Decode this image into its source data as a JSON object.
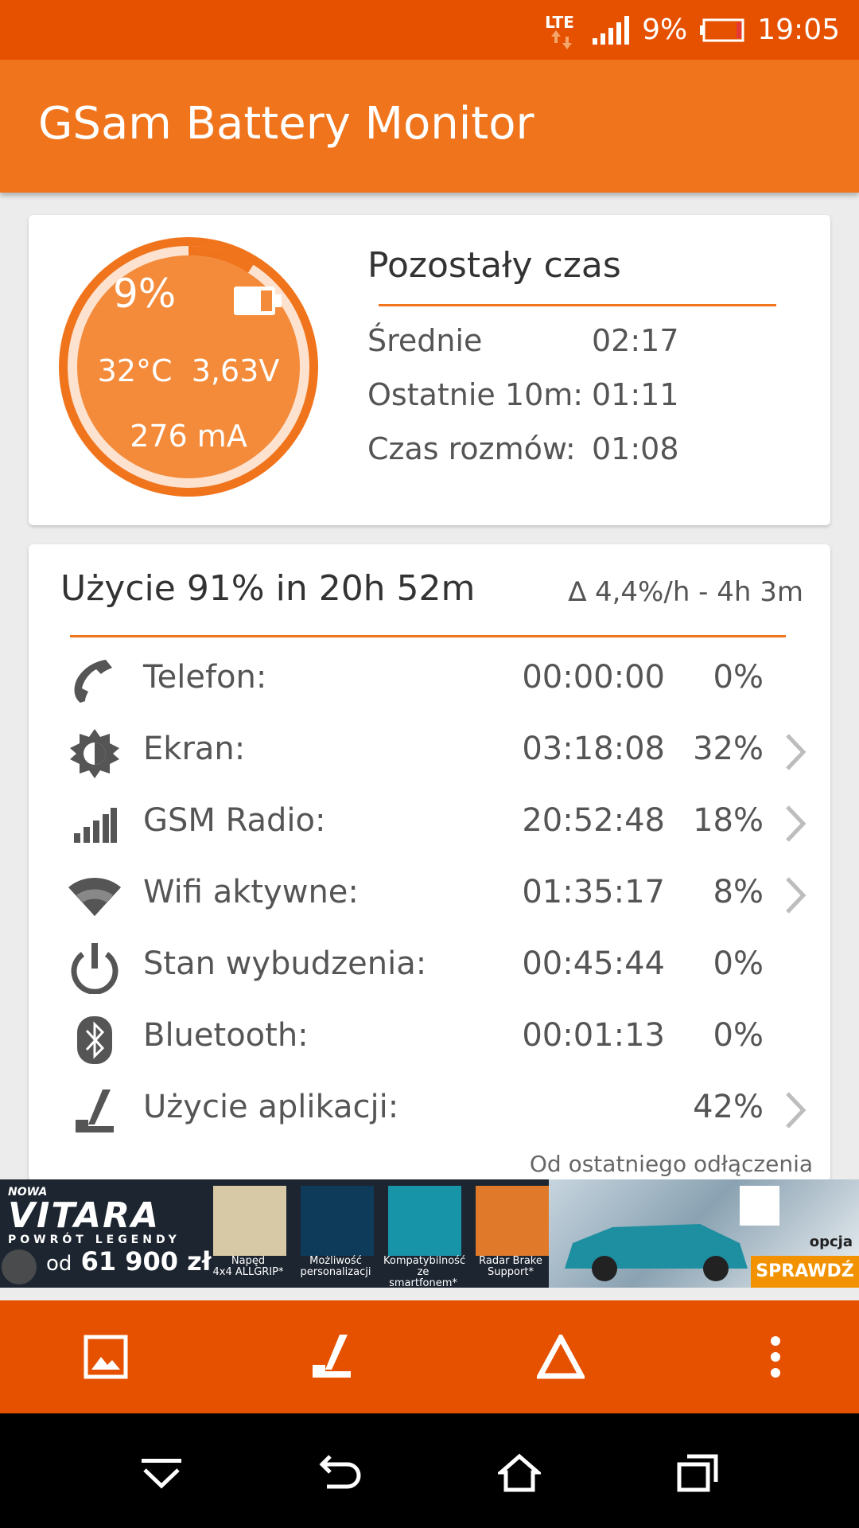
{
  "status_bar": {
    "network": "LTE",
    "battery_percent": "9%",
    "time": "19:05"
  },
  "app": {
    "title": "GSam Battery Monitor"
  },
  "battery": {
    "percent_text": "9%",
    "level": 0.09,
    "temperature": "32°C",
    "voltage": "3,63V",
    "current": "276 mA"
  },
  "remaining": {
    "title": "Pozostały czas",
    "rows": [
      {
        "label": "Średnie",
        "value": "02:17"
      },
      {
        "label": "Ostatnie 10m:",
        "value": "01:11"
      },
      {
        "label": "Czas rozmów:",
        "value": "01:08"
      }
    ]
  },
  "usage": {
    "title": "Użycie 91% in 20h 52m",
    "delta": "∆ 4,4%/h - 4h 3m",
    "rows": [
      {
        "icon": "phone-icon",
        "label": "Telefon:",
        "time": "00:00:00",
        "percent": "0%",
        "has_chevron": false
      },
      {
        "icon": "brightness-icon",
        "label": "Ekran:",
        "time": "03:18:08",
        "percent": "32%",
        "has_chevron": true
      },
      {
        "icon": "signal-icon",
        "label": "GSM Radio:",
        "time": "20:52:48",
        "percent": "18%",
        "has_chevron": true
      },
      {
        "icon": "wifi-icon",
        "label": "Wifi aktywne:",
        "time": "01:35:17",
        "percent": "8%",
        "has_chevron": true
      },
      {
        "icon": "power-icon",
        "label": "Stan wybudzenia:",
        "time": "00:45:44",
        "percent": "0%",
        "has_chevron": false
      },
      {
        "icon": "bluetooth-icon",
        "label": "Bluetooth:",
        "time": "00:01:13",
        "percent": "0%",
        "has_chevron": false
      },
      {
        "icon": "app-usage-icon",
        "label": "Użycie aplikacji:",
        "time": "",
        "percent": "42%",
        "has_chevron": true
      }
    ],
    "footer": "Od ostatniego odłączenia"
  },
  "ad": {
    "small_top": "NOWA",
    "brand": "VITARA",
    "tagline": "POWRÓT LEGENDY",
    "price_prefix": "od",
    "price": "61 900 zł",
    "features": [
      {
        "line1": "Napęd",
        "line2": "4x4 ALLGRIP*"
      },
      {
        "line1": "Możliwość",
        "line2": "personalizacji"
      },
      {
        "line1": "Kompatybilność",
        "line2": "ze smartfonem*"
      },
      {
        "line1": "Radar Brake",
        "line2": "Support*"
      }
    ],
    "option": "opcja",
    "cta": "SPRAWDŹ"
  },
  "bottom_bar": [
    "image-icon",
    "app-usage-icon",
    "delta-icon",
    "more-vert-icon"
  ],
  "nav_bar": [
    "notifications-down-icon",
    "back-icon",
    "home-icon",
    "recents-icon"
  ],
  "colors": {
    "accent": "#f0741c",
    "dark_accent": "#e65100",
    "gauge_fill": "#f48b3a"
  }
}
